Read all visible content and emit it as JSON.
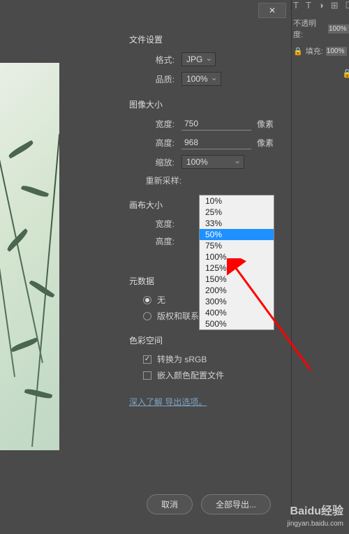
{
  "titlebar": {
    "close": "✕"
  },
  "top_icons": [
    "T",
    "T",
    "◑",
    "⊞",
    "☐"
  ],
  "right_panel": {
    "opacity_label": "不透明度:",
    "opacity_value": "100%",
    "lock_label": "填充:",
    "lock_value": "100%",
    "lock_icon": "🔒"
  },
  "file_settings": {
    "title": "文件设置",
    "format_label": "格式:",
    "format_value": "JPG",
    "quality_label": "品质:",
    "quality_value": "100%"
  },
  "image_size": {
    "title": "图像大小",
    "width_label": "宽度:",
    "width_value": "750",
    "height_label": "高度:",
    "height_value": "968",
    "unit": "像素",
    "scale_label": "缩放:",
    "scale_value": "100%",
    "resample_label": "重新采样:",
    "options": [
      "10%",
      "25%",
      "33%",
      "50%",
      "75%",
      "100%",
      "125%",
      "150%",
      "200%",
      "300%",
      "400%",
      "500%"
    ],
    "selected_option": "50%"
  },
  "canvas_size": {
    "title": "画布大小",
    "width_label": "宽度:",
    "height_label": "高度:"
  },
  "metadata": {
    "title": "元数据",
    "none": "无",
    "copyright": "版权和联系信息"
  },
  "colorspace": {
    "title": "色彩空间",
    "srgb": "转换为 sRGB",
    "embed": "嵌入颜色配置文件"
  },
  "learn_more": "深入了解 导出选项。",
  "buttons": {
    "cancel": "取消",
    "export": "全部导出..."
  },
  "watermark": {
    "brand": "Baidu经验",
    "url": "jingyan.baidu.com"
  }
}
